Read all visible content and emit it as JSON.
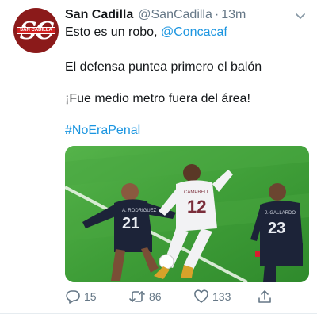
{
  "tweet": {
    "avatar_letters": "SC",
    "avatar_band_text": "SAN CADILLA",
    "display_name": "San Cadilla",
    "handle": "@SanCadilla",
    "separator": "·",
    "time": "13m",
    "line1_text": "Esto es un robo, ",
    "line1_mention": "@Concacaf",
    "line2": "El defensa puntea primero el balón",
    "line3": "¡Fue medio metro fuera del área!",
    "hashtag": "#NoEraPenal"
  },
  "media": {
    "player_left_jersey": "21",
    "player_left_name": "A. RODRIGUEZ",
    "player_center_jersey": "12",
    "player_center_name": "CAMPBELL",
    "player_right_jersey": "23",
    "player_right_name": "J. GALLARDO",
    "colors": {
      "pitch": "#3f9e38",
      "navy_kit": "#1c2338",
      "white_kit": "#f2f2f4"
    }
  },
  "actions": {
    "reply_count": "15",
    "retweet_count": "86",
    "like_count": "133"
  },
  "icons": [
    "caret-down-icon",
    "reply-icon",
    "retweet-icon",
    "like-icon",
    "share-icon"
  ]
}
